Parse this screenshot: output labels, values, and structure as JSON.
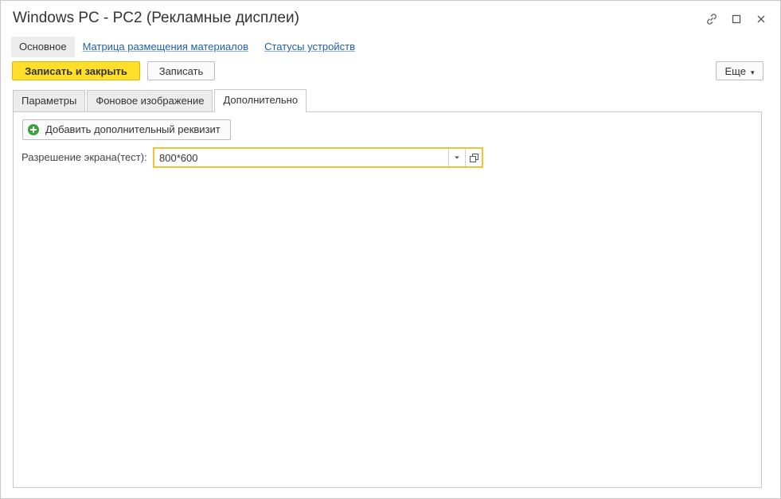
{
  "window": {
    "title": "Windows PC - PC2 (Рекламные дисплеи)"
  },
  "section_tabs": [
    {
      "label": "Основное"
    },
    {
      "label": "Матрица размещения материалов"
    },
    {
      "label": "Статусы устройств"
    }
  ],
  "toolbar": {
    "save_close_label": "Записать и закрыть",
    "save_label": "Записать",
    "more_label": "Еще"
  },
  "page_tabs": [
    {
      "label": "Параметры"
    },
    {
      "label": "Фоновое изображение"
    },
    {
      "label": "Дополнительно"
    }
  ],
  "panel": {
    "add_button_label": "Добавить дополнительный реквизит",
    "field_label": "Разрешение экрана(тест):",
    "field_value": "800*600"
  },
  "colors": {
    "primary_button": "#ffdf2a",
    "field_focus_border": "#f1c232",
    "link": "#1c5fae",
    "add_icon": "#3aa23a"
  },
  "icons": [
    "link-icon",
    "maximize-icon",
    "close-icon",
    "add-icon",
    "dropdown-icon",
    "open-icon"
  ]
}
